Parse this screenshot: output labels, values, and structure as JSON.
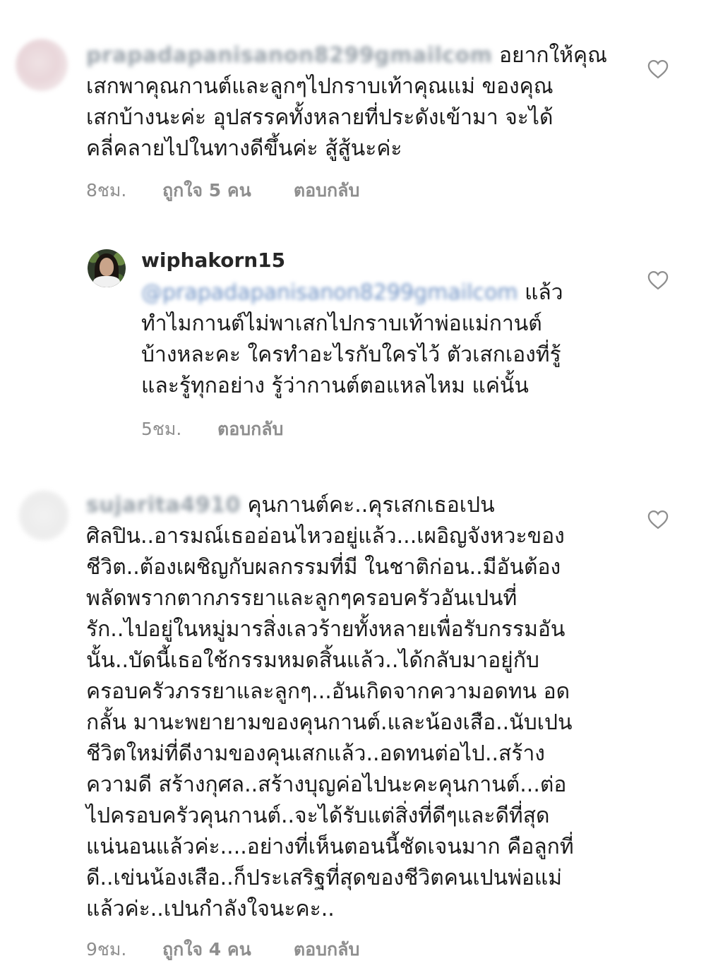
{
  "comments": [
    {
      "username": "prapadapanisanon8299gmailcom",
      "text_lines": [
        "อยากให้คุณ",
        "เสกพาคุณกานต์และลูกๆไปกราบเท้าคุณแม่ ของคุณ",
        "เสกบ้างนะค่ะ อุปสรรคทั้งหลายที่ประดังเข้ามา จะได้",
        "คลี่คลายไปในทางดีขึ้นค่ะ สู้สู้นะค่ะ"
      ],
      "time": "8ชม.",
      "likes": "ถูกใจ 5 คน",
      "reply": "ตอบกลับ",
      "like_icon": "heart-outline-icon"
    },
    {
      "username": "wiphakorn15",
      "mention": "@prapadapanisanon8299gmailcom",
      "text_lines": [
        "แล้ว",
        "ทำไมกานต์ไม่พาเสกไปกราบเท้าพ่อแม่กานต์",
        "บ้างหละคะ ใครทำอะไรกับใครไว้ ตัวเสกเองที่รู้",
        "และรู้ทุกอย่าง รู้ว่ากานต์ตอแหลไหม แค่นั้น"
      ],
      "time": "5ชม.",
      "reply": "ตอบกลับ",
      "like_icon": "heart-outline-icon"
    },
    {
      "username": "sujarita4910",
      "text_lines": [
        "คุนกานต์คะ..คุรเสกเธอเปน",
        "ศิลปิน..อารมณ์เธออ่อนไหวอยู่แล้ว...เผอิญจังหวะของ",
        "ชีวิต..ต้องเผชิญกับผลกรรมที่มี ในชาติก่อน..มีอันต้อง",
        "พลัดพรากตากภรรยาและลูกๆครอบครัวอันเปนที่",
        "รัก..ไปอยู่ในหมู่มารสิ่งเลวร้ายทั้งหลายเพื่อรับกรรมอัน",
        "นั้น..บัดนี้เธอใช้กรรมหมดสิ้นแล้ว..ได้กลับมาอยู่กับ",
        "ครอบครัวภรรยาและลูกๆ...อันเกิดจากความอดทน อด",
        "กลั้น มานะพยายามของคุนกานต์.และน้องเสือ..นับเปน",
        "ชีวิตใหม่ที่ดีงามของคุนเสกแล้ว..อดทนต่อไป..สร้าง",
        "ความดี สร้างกุศล..สร้างบุญค่อไปนะคะคุนกานต์...ต่อ",
        "ไปครอบครัวคุนกานต์..จะได้รับแต่สิ่งที่ดีๆและดีที่สุด",
        "แน่นอนแล้วค่ะ....อย่างที่เห็นตอนนี้ชัดเจนมาก คือลูกที่",
        "ดี..เข่นน้องเสือ..ก็ประเสริฐที่สุดของชีวิตคนเปนพ่อแม่",
        "แล้วค่ะ..เปนกำลังใจนะคะ.."
      ],
      "time": "9ชม.",
      "likes": "ถูกใจ 4 คน",
      "reply": "ตอบกลับ",
      "like_icon": "heart-outline-icon"
    }
  ],
  "colors": {
    "text": "#1a1a1a",
    "meta": "#8e8e8e",
    "username": "#262626",
    "mention": "#6a8ec2",
    "heart_stroke": "#8e8e8e"
  }
}
